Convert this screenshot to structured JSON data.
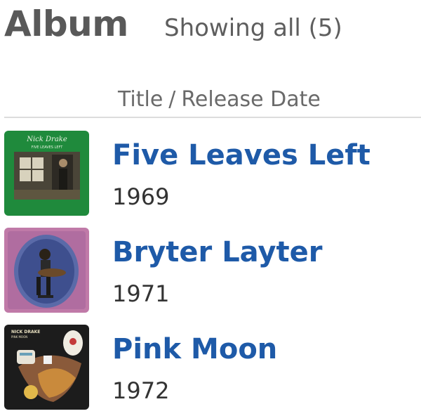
{
  "header": {
    "title": "Album",
    "count_label": "Showing all (5)"
  },
  "sort": {
    "primary": "Title",
    "separator": "/",
    "secondary": "Release Date"
  },
  "albums": [
    {
      "title": "Five Leaves Left",
      "year": "1969",
      "cover_text": "Nick Drake",
      "cover_subtext": "FIVE LEAVES LEFT"
    },
    {
      "title": "Bryter Layter",
      "year": "1971"
    },
    {
      "title": "Pink Moon",
      "year": "1972",
      "cover_text": "NICK DRAKE",
      "cover_subtext": "PINK MOON"
    }
  ],
  "colors": {
    "title_gray": "#595959",
    "link_blue": "#1e5aa8",
    "year_text": "#333333"
  }
}
